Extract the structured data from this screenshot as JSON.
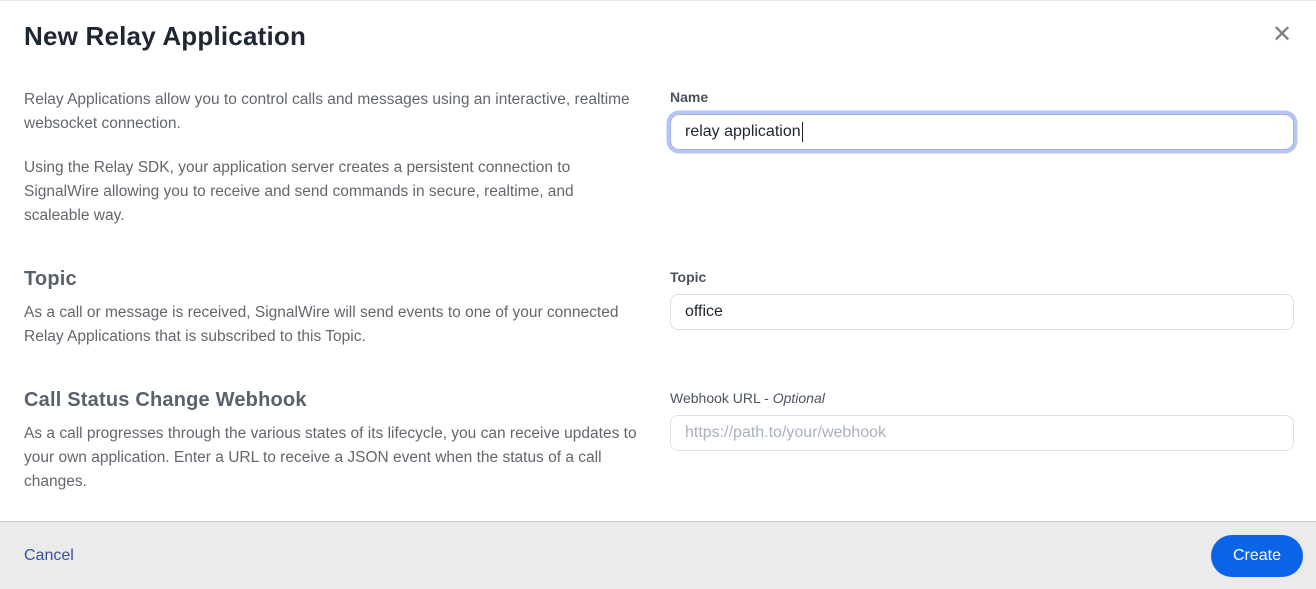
{
  "modal": {
    "title": "New Relay Application"
  },
  "icons": {
    "close": "✕"
  },
  "intro": {
    "paragraph1": "Relay Applications allow you to control calls and messages using an interactive, realtime websocket connection.",
    "paragraph2": "Using the Relay SDK, your application server creates a persistent connection to SignalWire allowing you to receive and send commands in secure, realtime, and scaleable way."
  },
  "sections": {
    "topic": {
      "heading": "Topic",
      "description": "As a call or message is received, SignalWire will send events to one of your connected Relay Applications that is subscribed to this Topic."
    },
    "webhook": {
      "heading": "Call Status Change Webhook",
      "description": "As a call progresses through the various states of its lifecycle, you can receive updates to your own application. Enter a URL to receive a JSON event when the status of a call changes."
    }
  },
  "form": {
    "name": {
      "label": "Name",
      "value": "relay application",
      "focused": true
    },
    "topic": {
      "label": "Topic",
      "value": "office"
    },
    "webhook": {
      "label": "Webhook URL - ",
      "optional_label": "Optional",
      "value": "",
      "placeholder": "https://path.to/your/webhook"
    }
  },
  "footer": {
    "cancel_label": "Cancel",
    "create_label": "Create"
  },
  "colors": {
    "accent_blue": "#0b63e8",
    "link_blue": "#36509e",
    "focus_ring": "#b9c6f4",
    "footer_bg": "#ebebeb",
    "heading_slate": "#59626c",
    "body_gray": "#62676e"
  }
}
